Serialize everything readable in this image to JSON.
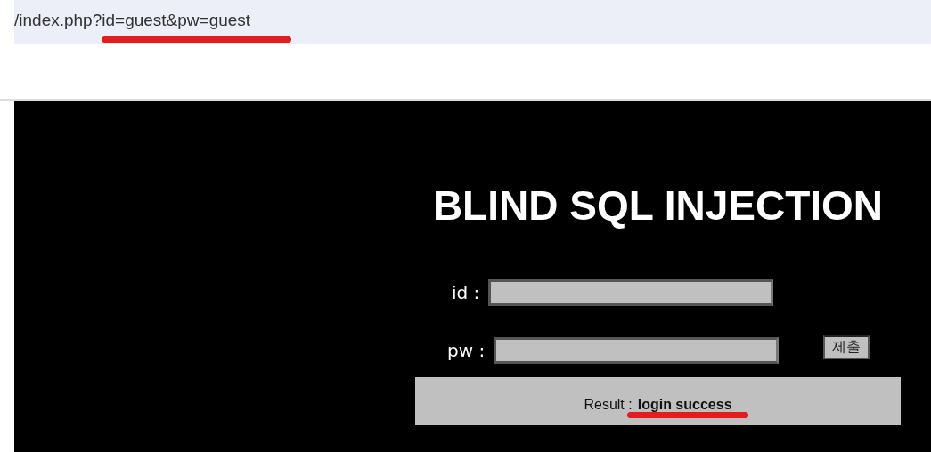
{
  "address_bar": {
    "url": "/index.php?id=guest&pw=guest"
  },
  "page": {
    "title": "BLIND SQL INJECTION",
    "fields": [
      {
        "label": "id :"
      },
      {
        "label": "pw :"
      }
    ],
    "submit_button": "제출",
    "result": {
      "label": "Result :",
      "value": "login success"
    }
  }
}
